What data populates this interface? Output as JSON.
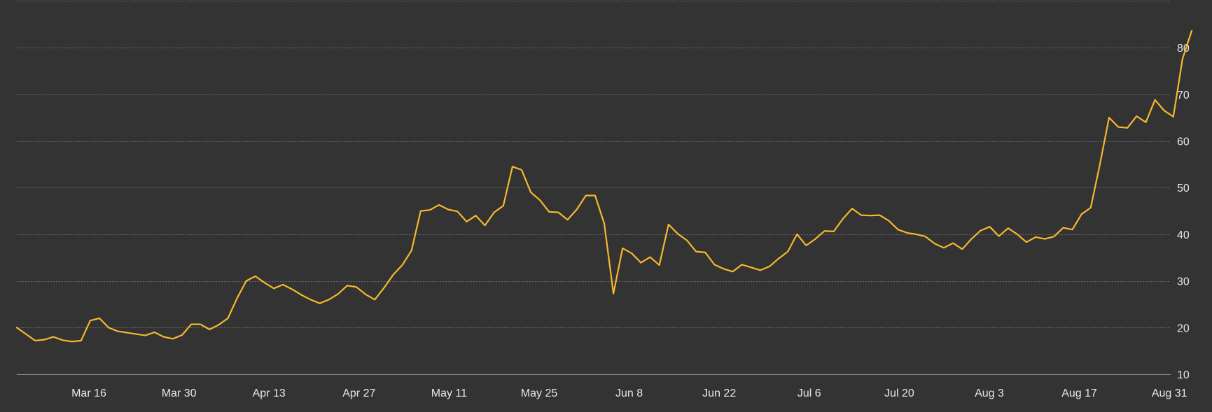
{
  "chart_data": {
    "type": "line",
    "title": "",
    "xlabel": "",
    "ylabel": "",
    "grid": true,
    "y_axis_side": "right",
    "ylim": [
      10,
      90
    ],
    "y_ticks": [
      10,
      20,
      30,
      40,
      50,
      60,
      70,
      80
    ],
    "x_tick_labels": [
      "Mar 16",
      "Mar 30",
      "Apr 13",
      "Apr 27",
      "May 11",
      "May 25",
      "Jun 8",
      "Jun 22",
      "Jul 6",
      "Jul 20",
      "Aug 3",
      "Aug 17",
      "Aug 31"
    ],
    "colors": {
      "line": "#f5b82e",
      "background": "#333333",
      "grid": "#6b6b6b",
      "text": "#e6e6e6"
    },
    "series": [
      {
        "values": [
          20.0,
          18.6,
          17.2,
          17.4,
          18.0,
          17.3,
          17.0,
          17.2,
          21.5,
          22.0,
          20.0,
          19.2,
          18.9,
          18.6,
          18.3,
          19.0,
          18.0,
          17.6,
          18.4,
          20.7,
          20.7,
          19.6,
          20.6,
          22.0,
          26.3,
          30.0,
          31.0,
          29.6,
          28.4,
          29.2,
          28.2,
          27.0,
          26.0,
          25.2,
          26.0,
          27.2,
          29.0,
          28.7,
          27.1,
          26.0,
          28.5,
          31.3,
          33.4,
          36.5,
          45.0,
          45.2,
          46.3,
          45.3,
          44.9,
          42.7,
          44.0,
          41.9,
          44.7,
          46.1,
          54.5,
          53.8,
          49.0,
          47.3,
          44.8,
          44.7,
          43.1,
          45.3,
          48.3,
          48.3,
          42.3,
          27.3,
          37.0,
          35.9,
          33.9,
          35.1,
          33.4,
          42.1,
          40.1,
          38.7,
          36.3,
          36.1,
          33.5,
          32.6,
          32.0,
          33.5,
          32.9,
          32.3,
          33.1,
          34.8,
          36.3,
          40.0,
          37.6,
          39.0,
          40.7,
          40.6,
          43.3,
          45.5,
          44.1,
          44.0,
          44.1,
          42.9,
          41.0,
          40.3,
          40.0,
          39.5,
          38.0,
          37.1,
          38.1,
          36.8,
          39.0,
          40.8,
          41.6,
          39.6,
          41.3,
          40.0,
          38.3,
          39.4,
          39.0,
          39.5,
          41.4,
          41.0,
          44.3,
          45.7,
          55.0,
          65.0,
          63.0,
          62.8,
          65.3,
          64.0,
          68.8,
          66.5,
          65.2,
          77.6,
          83.6
        ]
      }
    ]
  }
}
